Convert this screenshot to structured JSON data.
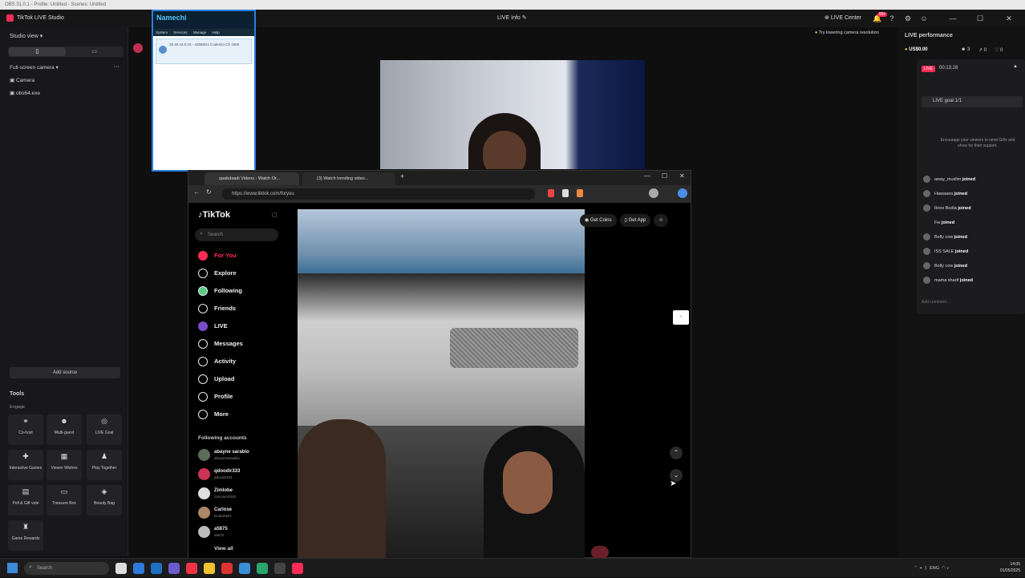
{
  "obs_strip": "OBS 31.0.1 - Profile: Untitled - Scenes: Untitled",
  "studio": {
    "title": "TikTok LIVE Studio",
    "center_title": "LIVE Info",
    "live_center": "LIVE Center",
    "notif_count": "99+",
    "camera_tip": "Try lowering camera resolution"
  },
  "left_panel": {
    "studio_view": "Studio view",
    "scene_header": "Full-screen camera",
    "sources": [
      "Camera",
      "obs64.exe"
    ],
    "add_source": "Add source",
    "tools_title": "Tools",
    "engage_label": "Engage",
    "tools": [
      "Co-host",
      "Multi-guest",
      "LIVE Goal",
      "Interactive Games",
      "Viewer Wishes",
      "Play Together",
      "Poll & Gift vote",
      "Treasure Box",
      "Beauty Bag",
      "Game Rewards"
    ]
  },
  "namechi": {
    "title": "Namechi",
    "menu": [
      "System",
      "Services",
      "Manage",
      "Help"
    ],
    "row_text": "25.40.44.0.18 - 43980D4 Codes/to Ch 1500"
  },
  "right_panel": {
    "title": "LIVE performance",
    "amount": "US$0.00",
    "viewers": "3",
    "stat_a": "0",
    "stat_b": "0",
    "live_badge": "LIVE",
    "timer": "00:13:28",
    "goal": "LIVE goal 1/1",
    "encourage": "Encourage your viewers to send Gifts and show for their support.",
    "joins": [
      {
        "name": "away_muslim",
        "action": "joined"
      },
      {
        "name": "Hawaaea",
        "action": "joined"
      },
      {
        "name": "Ibrox Bodia",
        "action": "joined"
      },
      {
        "name": "Fw",
        "action": "joined"
      },
      {
        "name": "Bolly cow",
        "action": "joined"
      },
      {
        "name": "ISS SALE",
        "action": "joined"
      },
      {
        "name": "Bolly cow",
        "action": "joined"
      },
      {
        "name": "mama sharif",
        "action": "joined"
      }
    ],
    "comment_placeholder": "Add comment..."
  },
  "browser": {
    "tab1": "qaabdaadi Videos - Watch Or...",
    "tab2": "(3) Watch trending video...",
    "url": "https://www.tiktok.com/foryou"
  },
  "tiktok": {
    "logo": "TikTok",
    "search_placeholder": "Search",
    "nav": [
      "For You",
      "Explore",
      "Following",
      "Friends",
      "LIVE",
      "Messages",
      "Activity",
      "Upload",
      "Profile",
      "More"
    ],
    "following_title": "Following accounts",
    "accounts": [
      {
        "name": "abayne sarabio",
        "handle": "abaynesaraabio"
      },
      {
        "name": "qdoodir333",
        "handle": "qdoodir333"
      },
      {
        "name": "Zimlobe",
        "handle": "zamzam2020"
      },
      {
        "name": "Carlose",
        "handle": "kinderbeltz"
      },
      {
        "name": "a5875",
        "handle": "a5875"
      }
    ],
    "view_all": "View all",
    "get_coins": "Get Coins",
    "get_app": "Get App"
  },
  "taskbar": {
    "search": "Search",
    "lang": "ENG",
    "time": "14:05",
    "date": "01/05/2025"
  },
  "colors": {
    "accent": "#fe2c55",
    "panel": "#18181a",
    "namechi_blue": "#2a7de1"
  }
}
